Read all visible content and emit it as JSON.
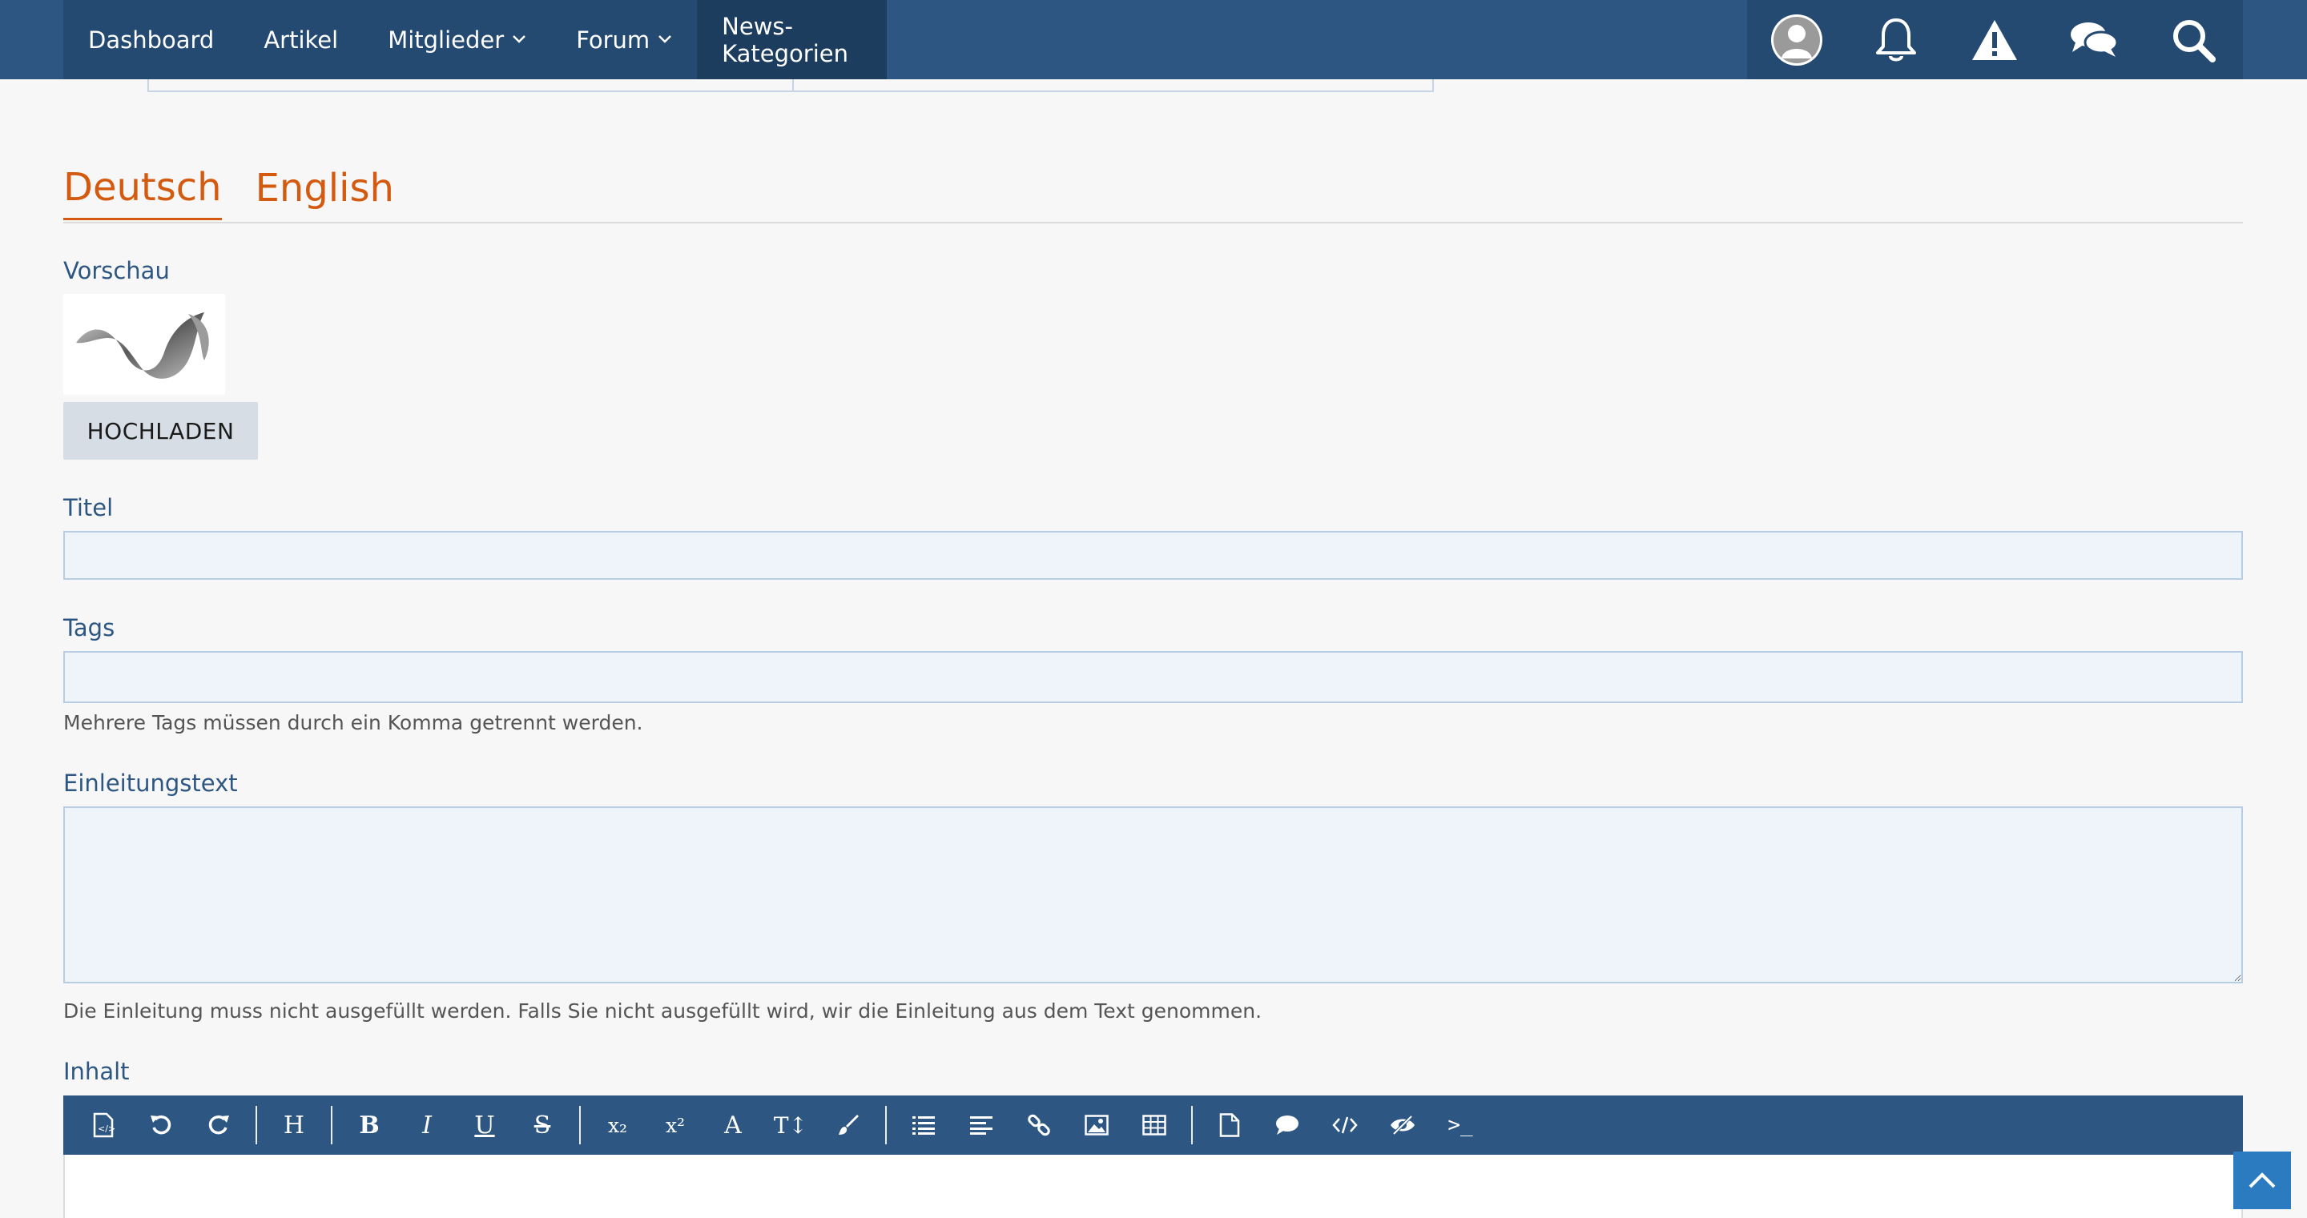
{
  "nav": {
    "items": [
      {
        "label": "Dashboard",
        "has_dropdown": false
      },
      {
        "label": "Artikel",
        "has_dropdown": false
      },
      {
        "label": "Mitglieder",
        "has_dropdown": true
      },
      {
        "label": "Forum",
        "has_dropdown": true
      }
    ],
    "active_item": "News-Kategorien",
    "icons": [
      "avatar-icon",
      "bell-icon",
      "warning-icon",
      "chat-icon",
      "search-icon"
    ]
  },
  "languages": {
    "tabs": [
      "Deutsch",
      "English"
    ],
    "active": "Deutsch"
  },
  "form": {
    "preview_label": "Vorschau",
    "upload_label": "HOCHLADEN",
    "title_label": "Titel",
    "title_value": "",
    "tags_label": "Tags",
    "tags_value": "",
    "tags_help": "Mehrere Tags müssen durch ein Komma getrennt werden.",
    "intro_label": "Einleitungstext",
    "intro_value": "",
    "intro_help": "Die Einleitung muss nicht ausgefüllt werden. Falls Sie nicht ausgefüllt wird, wir die Einleitung aus dem Text genommen.",
    "content_label": "Inhalt"
  },
  "editor": {
    "toolbar": {
      "heading": "H",
      "bold": "B",
      "italic": "I",
      "underline": "U",
      "strike": "S",
      "subscript": "x₂",
      "superscript": "x²",
      "font": "A",
      "font_size": "T↕",
      "terminal": ">_"
    }
  },
  "colors": {
    "nav_bg": "#2d5782",
    "accent": "#d45a0f",
    "label": "#2d5782",
    "scroll_top": "#2b7bc0"
  }
}
